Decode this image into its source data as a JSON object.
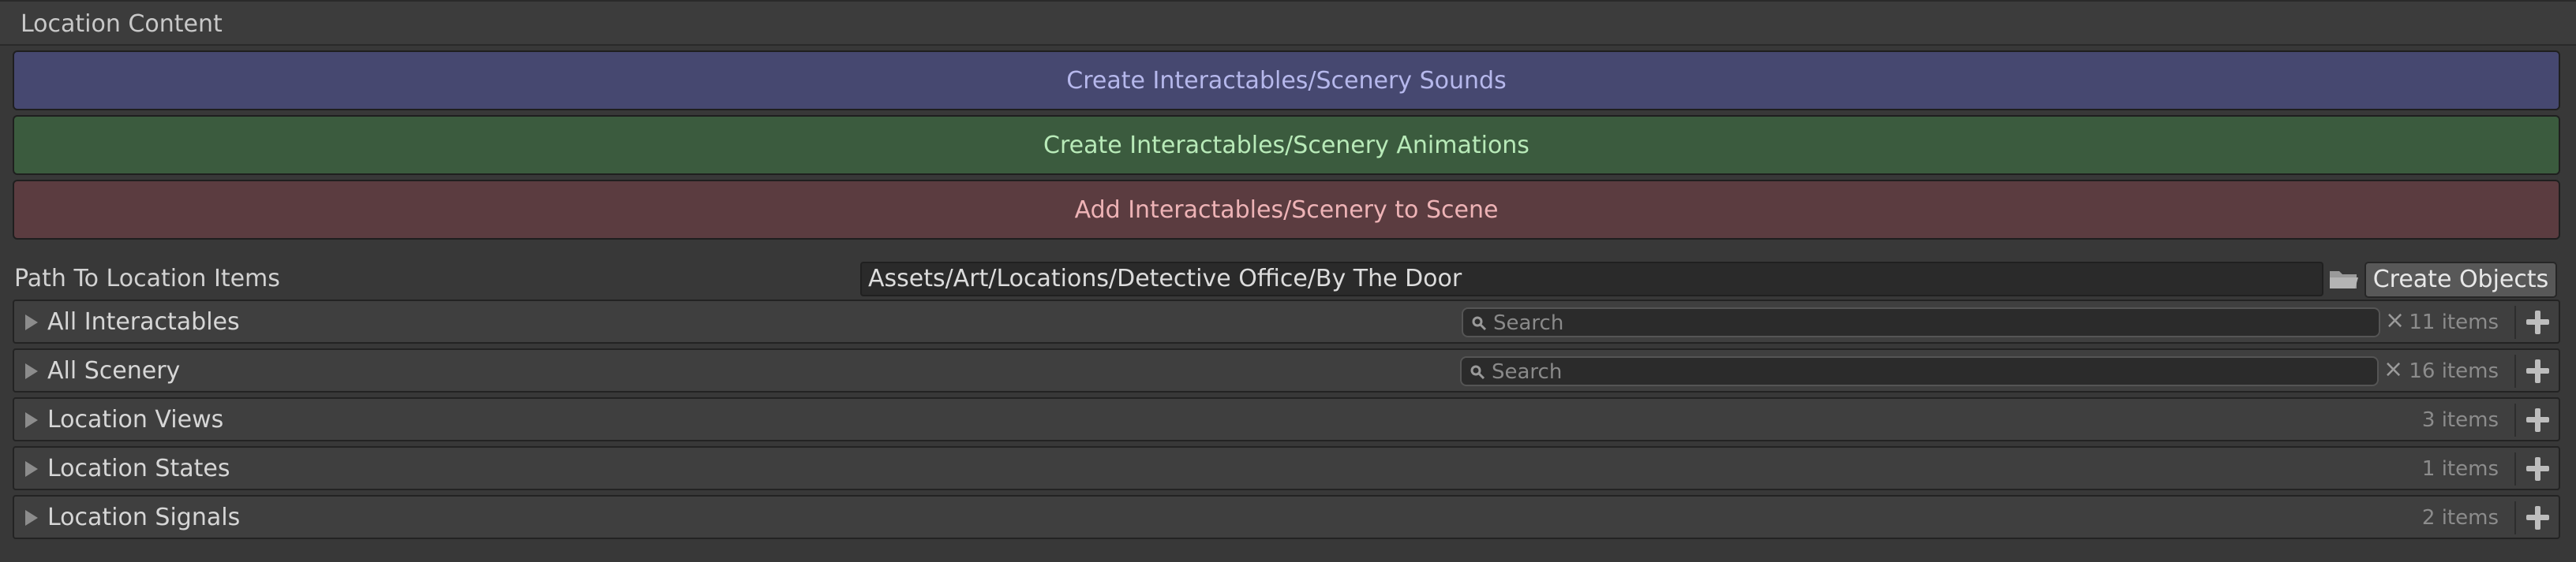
{
  "header": {
    "title": "Location Content"
  },
  "buttons": {
    "create_sounds": "Create Interactables/Scenery Sounds",
    "create_animations": "Create Interactables/Scenery Animations",
    "add_to_scene": "Add Interactables/Scenery to Scene"
  },
  "path": {
    "label": "Path To Location Items",
    "value": "Assets/Art/Locations/Detective Office/By The Door",
    "create_objects_label": "Create Objects",
    "folder_icon": "folder-icon"
  },
  "lists": [
    {
      "label": "All Interactables",
      "search_placeholder": "Search",
      "has_search": true,
      "clear": "×",
      "count": "11 items"
    },
    {
      "label": "All Scenery",
      "search_placeholder": "Search",
      "has_search": true,
      "clear": "×",
      "count": "16 items"
    },
    {
      "label": "Location Views",
      "has_search": false,
      "count": "3 items"
    },
    {
      "label": "Location States",
      "has_search": false,
      "count": "1 items"
    },
    {
      "label": "Location Signals",
      "has_search": false,
      "count": "2 items"
    }
  ],
  "colors": {
    "sounds_button_bg": "#464870",
    "animations_button_bg": "#3b5b3e",
    "add_button_bg": "#5b3c40"
  }
}
